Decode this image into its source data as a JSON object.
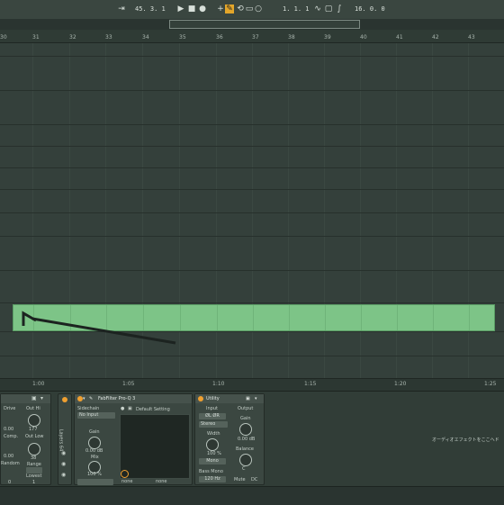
{
  "transport": {
    "tempo": "45. 3. 1",
    "position": "1. 1. 1",
    "loop_length": "16. 0. 0"
  },
  "ruler": {
    "bars": [
      "30",
      "31",
      "32",
      "33",
      "34",
      "35",
      "36",
      "37",
      "38",
      "39",
      "40",
      "41",
      "42",
      "43"
    ]
  },
  "timeline": {
    "times": [
      "1:00",
      "1:05",
      "1:10",
      "1:15",
      "1:20",
      "1:25"
    ]
  },
  "devices": {
    "saturator": {
      "drive_label": "Drive",
      "out_hi_label": "Out Hi",
      "drive_value": "0.00",
      "out_hi_value": "177",
      "comp_label": "Comp.",
      "out_low_label": "Out Low",
      "random_value": "0.00",
      "random_label": "Random",
      "range_value": "38",
      "range_label": "Range",
      "lowest_label": "Lowest",
      "bottom_left": "0",
      "bottom_right": "1"
    },
    "rack_label": "Layers 64",
    "fabfilter": {
      "title": "FabFilter Pro-Q 3",
      "sidechain_label": "Sidechain",
      "sidechain_value": "No Input",
      "gain_label": "Gain",
      "gain_value": "0.00 dB",
      "mix_label": "Mix",
      "mix_value": "100 %",
      "preset_name": "Default Setting",
      "preset_left": "none",
      "preset_right": "none"
    },
    "utility": {
      "title": "Utility",
      "input_label": "Input",
      "output_label": "Output",
      "input_mode": "ØL  ØR",
      "channel_mode": "Stereo",
      "gain_label": "Gain",
      "width_label": "Width",
      "gain_value": "0.00 dB",
      "width_value": "100 %",
      "balance_label": "Balance",
      "balance_value": "C",
      "mono_label": "Mono",
      "bass_mono_label": "Bass Mono",
      "bass_mono_freq": "120 Hz",
      "mute_label": "Mute",
      "dc_label": "DC"
    },
    "drop_hint": "オーディオエフェクトをここへド"
  },
  "colors": {
    "clip": "#7dc487",
    "power": "#f0a030",
    "background": "#34403b"
  }
}
